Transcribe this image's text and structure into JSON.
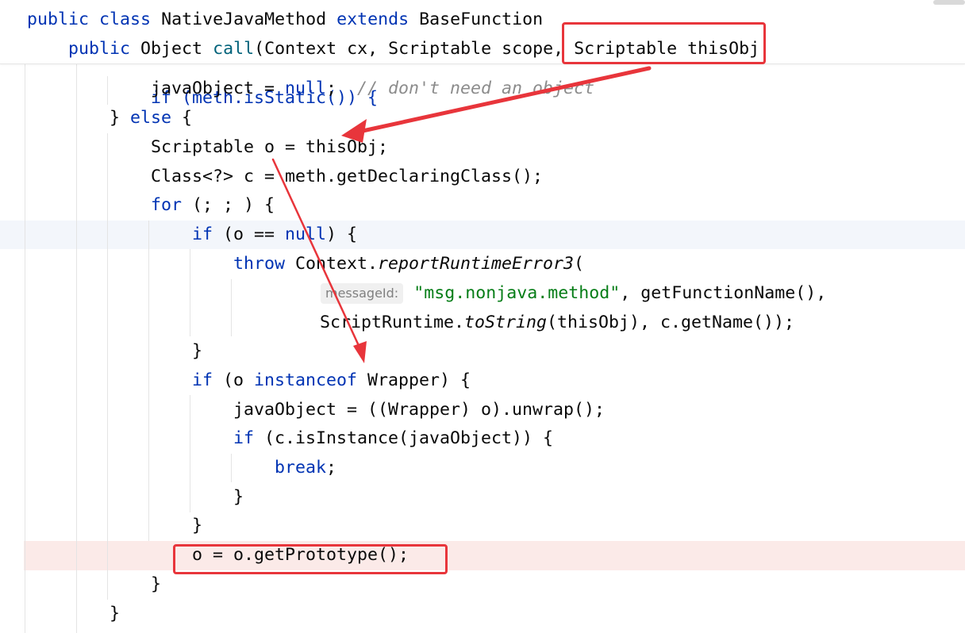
{
  "sticky_header": {
    "line1": {
      "kw1": "public",
      "kw2": "class",
      "name": "NativeJavaMethod",
      "kw3": "extends",
      "base": "BaseFunction"
    },
    "line2": {
      "kw1": "public",
      "type": "Object",
      "fn": "call",
      "params": "(Context cx, Scriptable scope, ",
      "highlighted_param": "Scriptable thisObj"
    }
  },
  "partial_line": "if (meth.isStatic()) {",
  "code": {
    "l1": {
      "text": "javaObject = ",
      "null_kw": "null",
      "semi": ";  ",
      "comment": "// don't need an object"
    },
    "l2": {
      "brace": "} ",
      "else_kw": "else",
      "rest": " {"
    },
    "l3": {
      "text": "Scriptable o = thisObj;"
    },
    "l4": {
      "text": "Class<?> c = meth.getDeclaringClass();"
    },
    "l5": {
      "for_kw": "for",
      "rest": " (; ; ) {"
    },
    "l6": {
      "if_kw": "if",
      "a": " (o == ",
      "null_kw": "null",
      "b": ") {"
    },
    "l7": {
      "throw_kw": "throw",
      "a": " Context.",
      "method": "reportRuntimeError3",
      "b": "("
    },
    "l8": {
      "hint": "messageId:",
      "string": "\"msg.nonjava.method\"",
      "rest": ", getFunctionName(),"
    },
    "l9": {
      "a": "ScriptRuntime.",
      "method": "toString",
      "b": "(thisObj), c.getName());"
    },
    "l10": {
      "text": "}"
    },
    "l11": {
      "if_kw": "if",
      "a": " (o ",
      "instanceof_kw": "instanceof",
      "b": " Wrapper) {"
    },
    "l12": {
      "text": "javaObject = ((Wrapper) o).unwrap();"
    },
    "l13": {
      "if_kw": "if",
      "rest": " (c.isInstance(javaObject)) {"
    },
    "l14": {
      "break_kw": "break",
      "semi": ";"
    },
    "l15": {
      "text": "}"
    },
    "l16": {
      "text": "}"
    },
    "l17": {
      "text": "o = o.getPrototype();"
    },
    "l18": {
      "text": "}"
    },
    "l19": {
      "text": "}"
    }
  },
  "colors": {
    "keyword": "#0033b3",
    "function": "#00627a",
    "string": "#067d17",
    "comment": "#8c8c8c",
    "annotation_red": "#e8353b",
    "breakpoint_line": "#fbeae8"
  }
}
